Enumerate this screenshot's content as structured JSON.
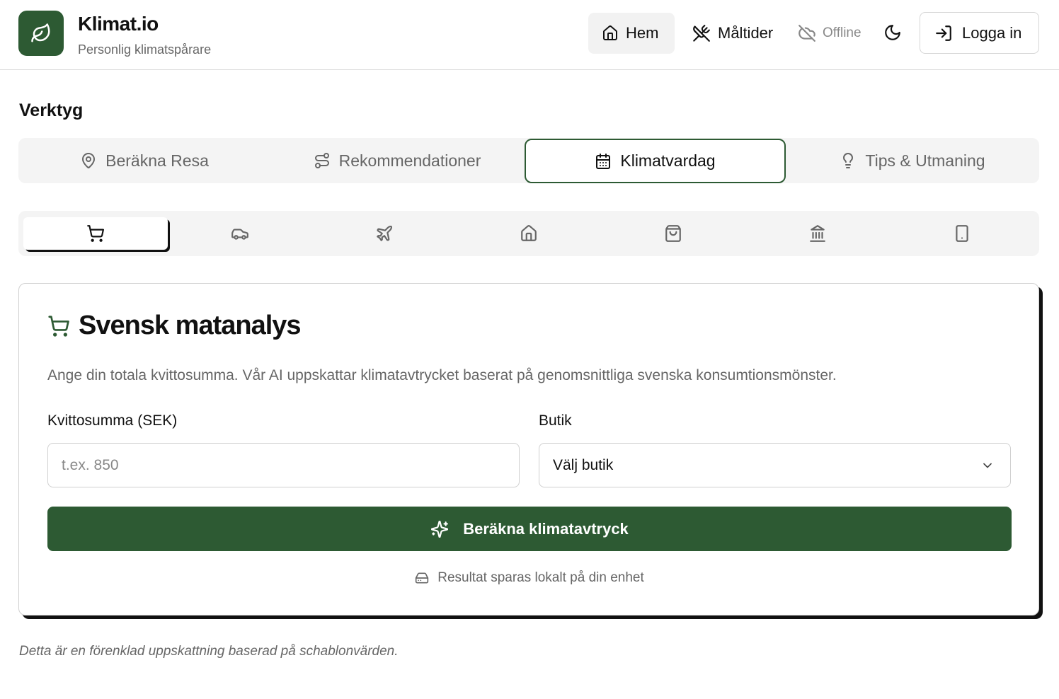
{
  "header": {
    "brand_title": "Klimat.io",
    "brand_subtitle": "Personlig klimatspårare",
    "logo_icon": "leaf-icon",
    "brand_color": "#2d5a33",
    "nav": {
      "home_label": "Hem",
      "meals_label": "Måltider",
      "offline_label": "Offline",
      "login_label": "Logga in"
    }
  },
  "tools": {
    "title": "Verktyg",
    "tabs": [
      {
        "label": "Beräkna Resa",
        "icon": "map-pin-icon"
      },
      {
        "label": "Rekommendationer",
        "icon": "route-icon"
      },
      {
        "label": "Klimatvardag",
        "icon": "calendar-icon",
        "active": true
      },
      {
        "label": "Tips & Utmaning",
        "icon": "lightbulb-icon"
      }
    ]
  },
  "categories": [
    {
      "icon": "shopping-cart-icon",
      "active": true
    },
    {
      "icon": "car-icon"
    },
    {
      "icon": "plane-icon"
    },
    {
      "icon": "house-icon"
    },
    {
      "icon": "shopping-bag-icon"
    },
    {
      "icon": "bank-icon"
    },
    {
      "icon": "smartphone-icon"
    }
  ],
  "card": {
    "title": "Svensk matanalys",
    "description": "Ange din totala kvittosumma. Vår AI uppskattar klimatavtrycket baserat på genomsnittliga svenska konsumtionsmönster.",
    "amount_label": "Kvittosumma (SEK)",
    "amount_placeholder": "t.ex. 850",
    "amount_value": "",
    "store_label": "Butik",
    "store_selected": "Välj butik",
    "calc_button": "Beräkna klimatavtryck",
    "storage_note": "Resultat sparas lokalt på din enhet"
  },
  "footnote": "Detta är en förenklad uppskattning baserad på schablonvärden."
}
